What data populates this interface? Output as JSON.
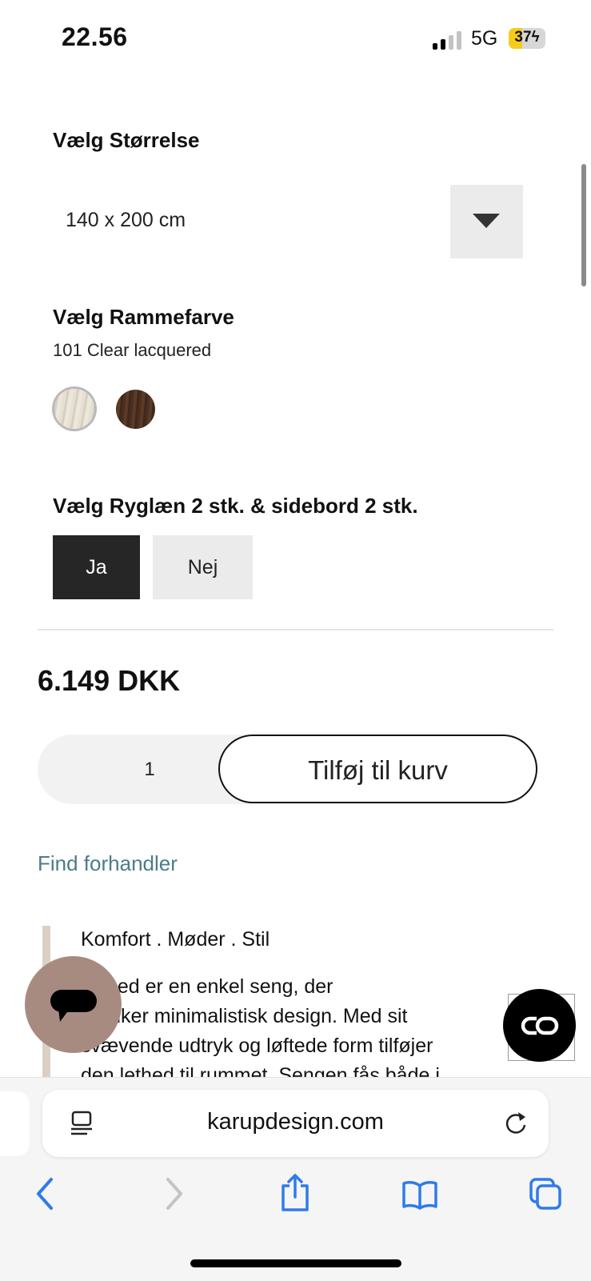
{
  "status_bar": {
    "time": "22.56",
    "network": "5G",
    "battery": "37",
    "battery_level": 0.37
  },
  "size": {
    "heading": "Vælg Størrelse",
    "selected": "140 x 200 cm"
  },
  "frame_color": {
    "heading": "Vælg Rammefarve",
    "selected": "101 Clear lacquered",
    "swatches": [
      {
        "name": "Clear lacquered",
        "color": "#e6e0d3"
      },
      {
        "name": "dark wood",
        "color": "#4a2f1f"
      }
    ]
  },
  "backrest": {
    "heading": "Vælg Ryglæn 2 stk. & sidebord 2 stk.",
    "options": [
      "Ja",
      "Nej"
    ],
    "selected": "Ja"
  },
  "price": "6.149 DKK",
  "cart": {
    "quantity": "1",
    "add_label": "Tilføj til kurv"
  },
  "find_dealer": "Find forhandler",
  "description": {
    "heading": "Komfort . Møder . Stil",
    "lines": [
      "ial bed er en enkel seng, der",
      "æenker minimalistisk design. Med sit",
      "svævende udtryk og løftede form tilføjer",
      "den lethed til rummet. Sengen fås både i"
    ]
  },
  "browser": {
    "url": "karupdesign.com"
  },
  "colors": {
    "accent_link": "#4b7c8a",
    "chat_bubble": "#a88b80",
    "selected_option": "#262626"
  }
}
